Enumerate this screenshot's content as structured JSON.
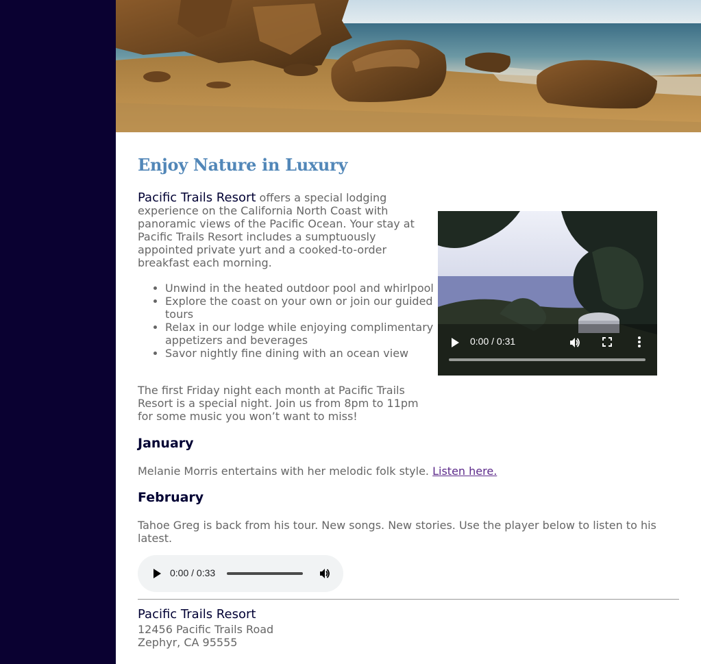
{
  "colors": {
    "page_background": "#0a0131",
    "content_background": "#ffffff",
    "heading": "#5287b8",
    "dark_text": "#000033",
    "body_text": "#666666",
    "visited_link": "#5c2a8a"
  },
  "hero": {
    "image": "beach-rocks-ocean"
  },
  "main": {
    "heading": "Enjoy Nature in Luxury",
    "intro_resort_name": "Pacific Trails Resort",
    "intro_text": " offers a special lodging experience on the California North Coast with panoramic views of the Pacific Ocean. Your stay at Pacific Trails Resort includes a sumptuously appointed private yurt and a cooked-to-order breakfast each morning.",
    "amenities": [
      "Unwind in the heated outdoor pool and whirlpool",
      "Explore the coast on your own or join our guided tours",
      "Relax in our lodge while enjoying complimentary appetizers and beverages",
      "Savor nightly fine dining with an ocean view"
    ],
    "friday_text": "The first Friday night each month at Pacific Trails Resort is a special night. Join us from 8pm to 11pm for some music you won’t want to miss!",
    "january": {
      "heading": "January",
      "text": "Melanie Morris entertains with her melodic folk style. ",
      "link_label": "Listen here."
    },
    "february": {
      "heading": "February",
      "text": "Tahoe Greg is back from his tour. New songs. New stories. Use the player below to listen to his latest."
    }
  },
  "video": {
    "time": "0:00 / 0:31",
    "progress": 0.0,
    "icons": [
      "play-icon",
      "volume-icon",
      "fullscreen-icon",
      "more-options-icon"
    ]
  },
  "audio": {
    "time": "0:00 / 0:33",
    "progress": 0.0,
    "icons": [
      "play-icon",
      "volume-icon"
    ]
  },
  "footer": {
    "name": "Pacific Trails Resort",
    "address_line1": "12456 Pacific Trails Road",
    "address_line2": "Zephyr, CA 95555"
  }
}
